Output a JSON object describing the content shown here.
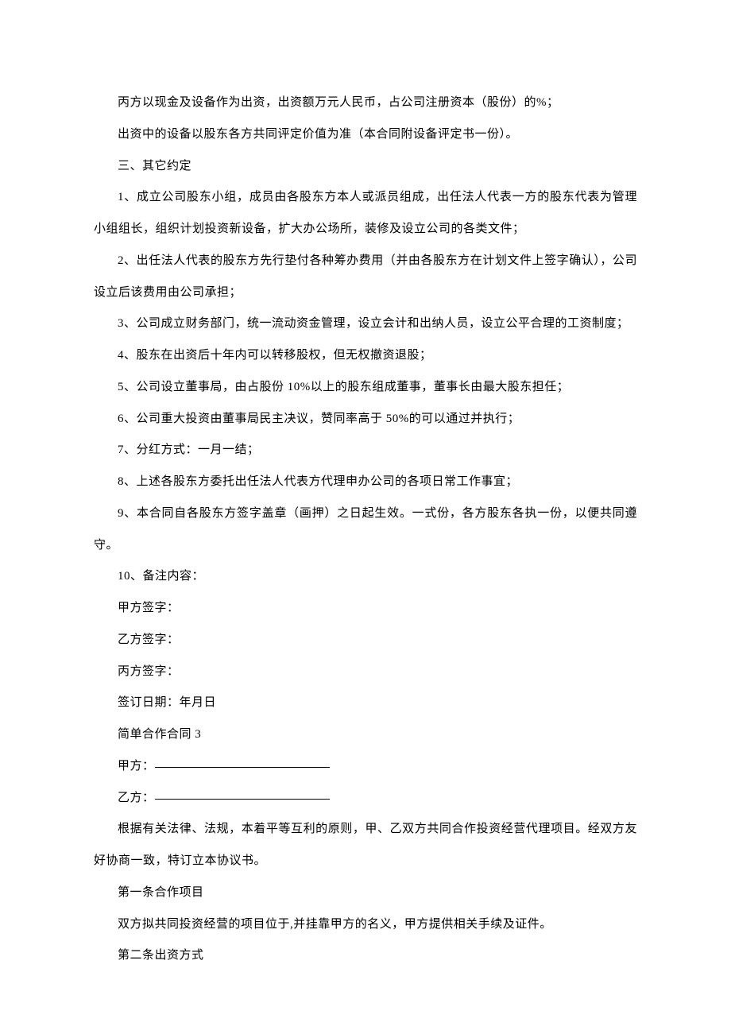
{
  "paragraphs": [
    "丙方以现金及设备作为出资，出资额万元人民币，占公司注册资本（股份）的%；",
    "出资中的设备以股东各方共同评定价值为准（本合同附设备评定书一份）。",
    "三、其它约定",
    "1、成立公司股东小组，成员由各股东方本人或派员组成，出任法人代表一方的股东代表为管理小组组长，组织计划投资新设备，扩大办公场所，装修及设立公司的各类文件；",
    "2、出任法人代表的股东方先行垫付各种筹办费用（并由各股东方在计划文件上签字确认），公司设立后该费用由公司承担；",
    "3、公司成立财务部门，统一流动资金管理，设立会计和出纳人员，设立公平合理的工资制度；",
    "4、股东在出资后十年内可以转移股权，但无权撤资退股；",
    "5、公司设立董事局，由占股份 10%以上的股东组成董事，董事长由最大股东担任；",
    "6、公司重大投资由董事局民主决议，赞同率高于 50%的可以通过并执行；",
    "7、分红方式：一月一结；",
    "8、上述各股东方委托出任法人代表方代理申办公司的各项日常工作事宜；",
    "9、本合同自各股东方签字盖章（画押）之日起生效。一式份，各方股东各执一份，以便共同遵守。",
    "10、备注内容：",
    "甲方签字：",
    "乙方签字：",
    "丙方签字：",
    "签订日期：年月日",
    "简单合作合同 3",
    "甲方：",
    "乙方：",
    "根据有关法律、法规，本着平等互利的原则，甲、乙双方共同合作投资经营代理项目。经双方友好协商一致，特订立本协议书。",
    "第一条合作项目",
    "双方拟共同投资经营的项目位于,并挂靠甲方的名义，甲方提供相关手续及证件。",
    "第二条出资方式"
  ]
}
